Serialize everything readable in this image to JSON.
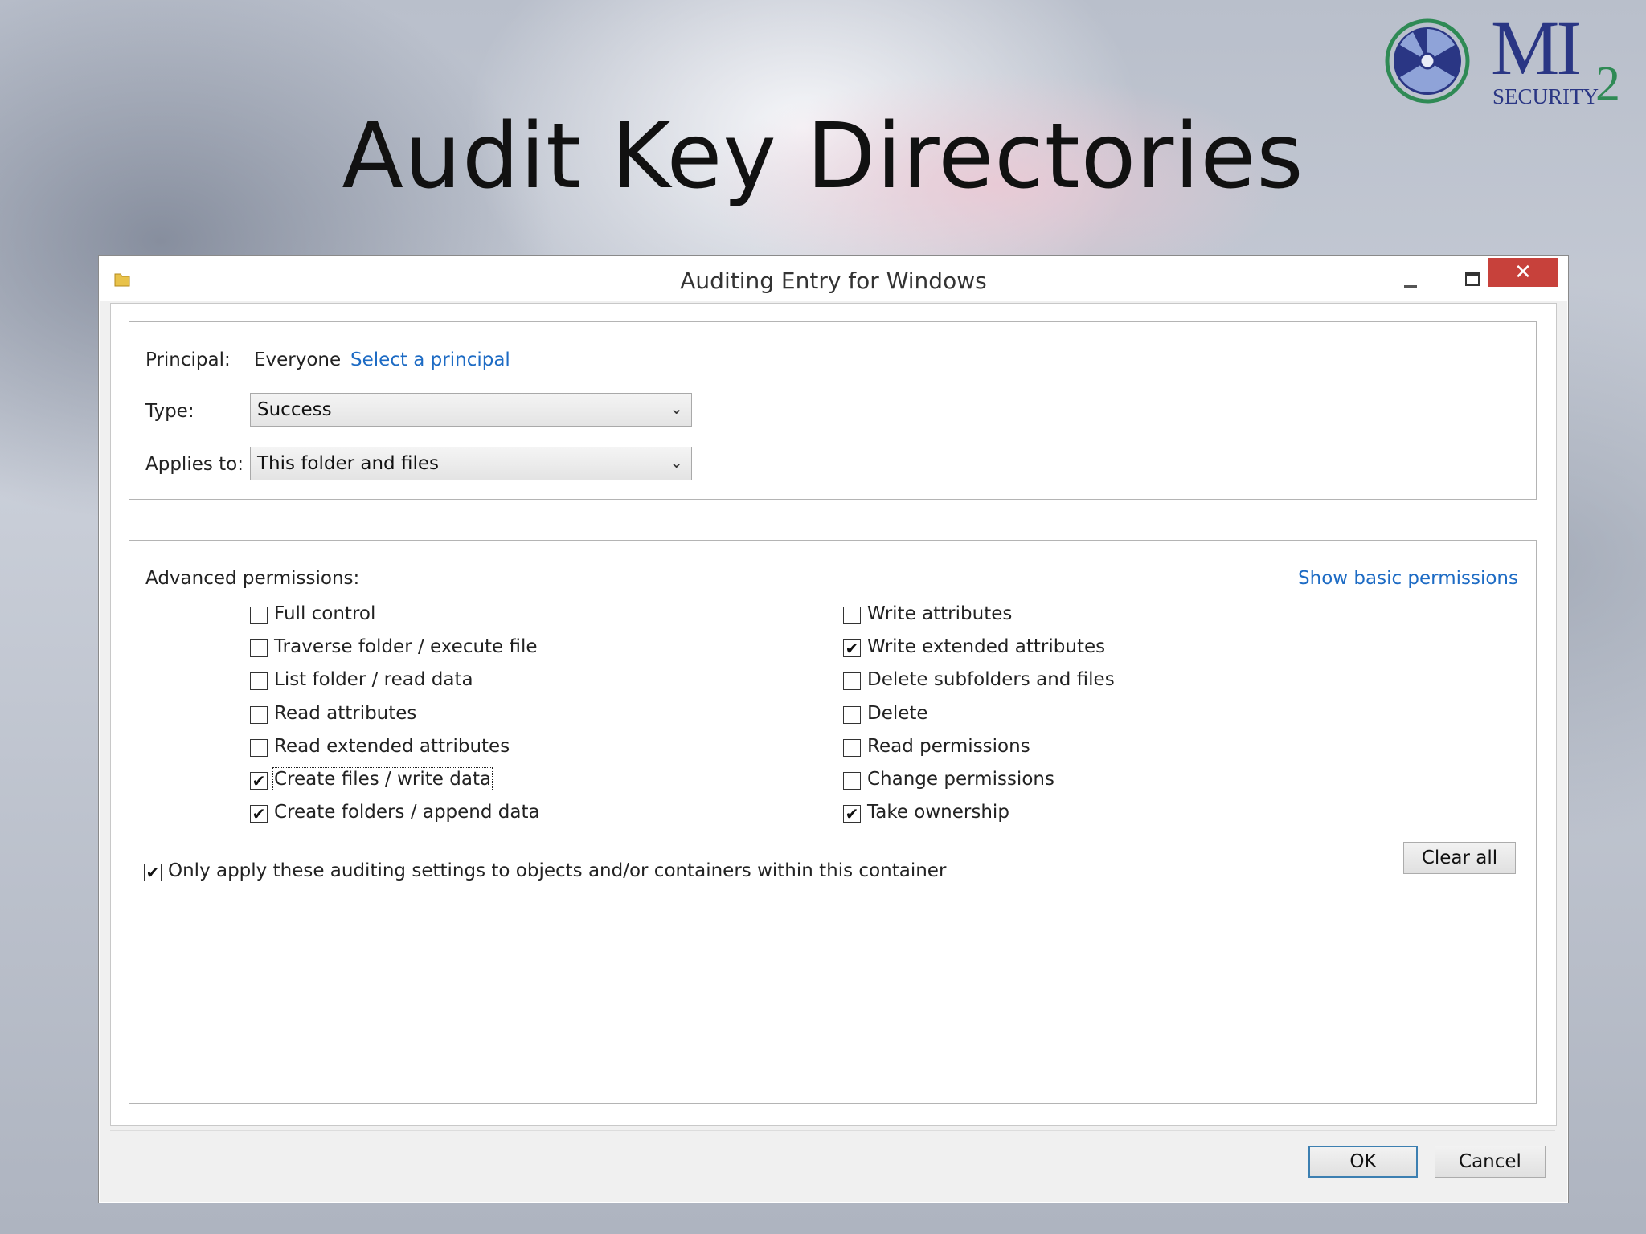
{
  "slide": {
    "title": "Audit Key Directories",
    "logo": {
      "word": "MI",
      "sub": "SECURITY",
      "num": "2"
    }
  },
  "dialog": {
    "title": "Auditing Entry for Windows",
    "principal_label": "Principal:",
    "principal_value": "Everyone",
    "select_principal_link": "Select a principal",
    "type_label": "Type:",
    "type_value": "Success",
    "applies_label": "Applies to:",
    "applies_value": "This folder and files",
    "advanced_label": "Advanced permissions:",
    "show_basic_link": "Show basic permissions",
    "permissions_left": [
      {
        "label": "Full control",
        "checked": false
      },
      {
        "label": "Traverse folder / execute file",
        "checked": false
      },
      {
        "label": "List folder / read data",
        "checked": false
      },
      {
        "label": "Read attributes",
        "checked": false
      },
      {
        "label": "Read extended attributes",
        "checked": false
      },
      {
        "label": "Create files / write data",
        "checked": true
      },
      {
        "label": "Create folders / append data",
        "checked": true
      }
    ],
    "permissions_right": [
      {
        "label": "Write attributes",
        "checked": false
      },
      {
        "label": "Write extended attributes",
        "checked": true
      },
      {
        "label": "Delete subfolders and files",
        "checked": false
      },
      {
        "label": "Delete",
        "checked": false
      },
      {
        "label": "Read permissions",
        "checked": false
      },
      {
        "label": "Change permissions",
        "checked": false
      },
      {
        "label": "Take ownership",
        "checked": true
      }
    ],
    "only_apply": {
      "label": "Only apply these auditing settings to objects and/or containers within this container",
      "checked": true
    },
    "clear_all": "Clear all",
    "ok": "OK",
    "cancel": "Cancel",
    "close_glyph": "✕"
  }
}
